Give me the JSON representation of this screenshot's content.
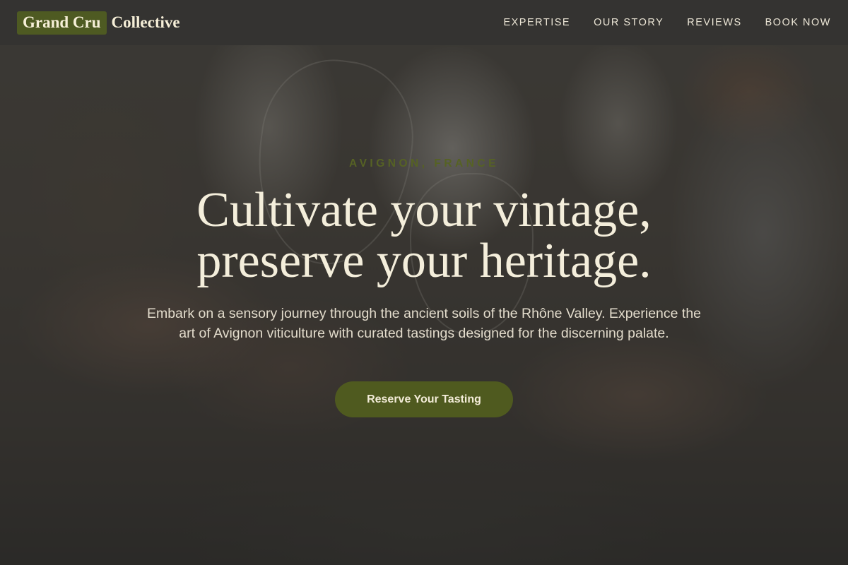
{
  "header": {
    "logo_badge": "Grand Cru",
    "logo_text": "Collective",
    "nav": [
      {
        "label": "EXPERTISE"
      },
      {
        "label": "OUR STORY"
      },
      {
        "label": "REVIEWS"
      },
      {
        "label": "BOOK NOW"
      }
    ]
  },
  "hero": {
    "eyebrow": "AVIGNON, FRANCE",
    "headline_line1": "Cultivate your vintage,",
    "headline_line2": "preserve your heritage.",
    "subtext": "Embark on a sensory journey through the ancient soils of the Rhône Valley. Experience the art of Avignon viticulture with curated tastings designed for the discerning palate.",
    "cta_label": "Reserve Your Tasting"
  },
  "colors": {
    "accent": "#4f5a1f",
    "cream": "#f4eedb",
    "header_bg": "#343331"
  }
}
